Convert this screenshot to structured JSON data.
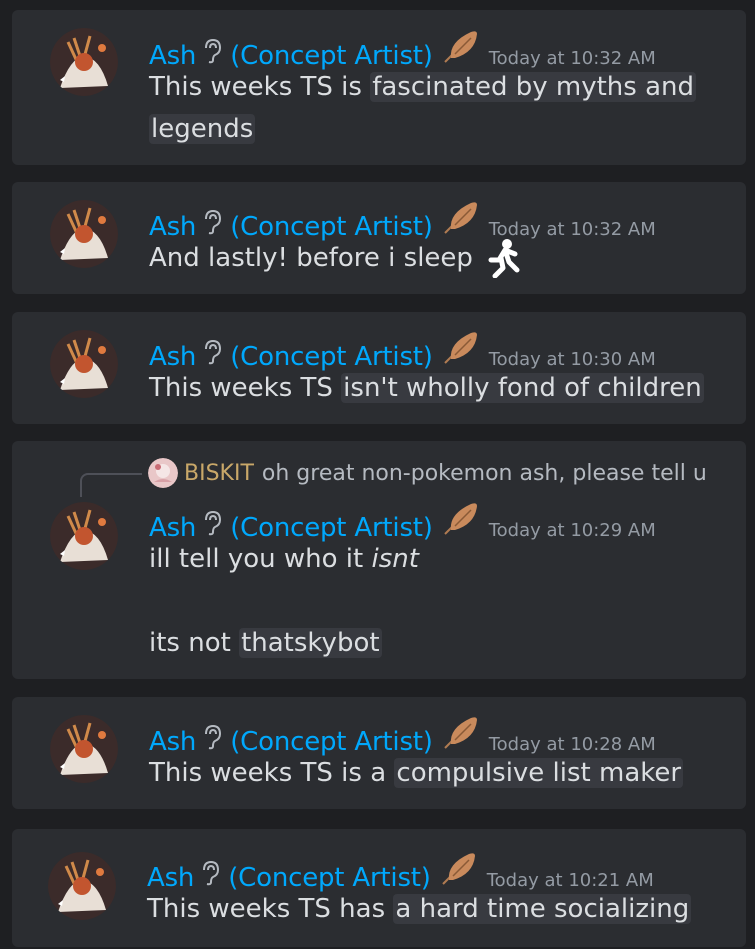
{
  "author": {
    "name": "Ash",
    "role": "(Concept Artist)",
    "name_color": "#00a8fc"
  },
  "icons": {
    "name_badge": "ear-icon",
    "role_badge": "feather-icon",
    "emoji": "person-running-icon"
  },
  "messages": [
    {
      "time": "Today at 10:32 AM",
      "plain": "This weeks TS is ",
      "highlight_line1": "fascinated by myths and",
      "highlight_line2": "legends"
    },
    {
      "time": "Today at 10:32 AM",
      "plain": "And lastly! before i sleep "
    },
    {
      "time": "Today at 10:30 AM",
      "plain": "This weeks TS ",
      "highlight": "isn't wholly fond of children"
    },
    {
      "time": "Today at 10:29 AM",
      "reply_name": "BISKIT",
      "reply_text": "oh great non-pokemon ash, please tell u",
      "line1_plain": "ill tell you who it ",
      "line1_italic": "isnt",
      "line2_plain": "its not ",
      "line2_highlight": "thatskybot"
    },
    {
      "time": "Today at 10:28 AM",
      "plain": "This weeks TS is a ",
      "highlight": "compulsive list maker"
    },
    {
      "time": "Today at 10:21 AM",
      "plain": "This weeks TS has ",
      "highlight": "a hard time socializing"
    }
  ],
  "colors": {
    "background": "#1e1f22",
    "card": "#2b2d31",
    "highlight": "#383a40",
    "text": "#dbdee1",
    "timestamp": "#949ba4",
    "reply_name": "#c9a869"
  }
}
